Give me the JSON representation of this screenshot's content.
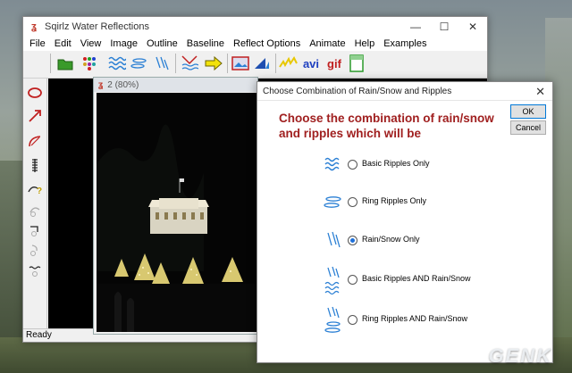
{
  "app": {
    "title": "Sqirlz Water Reflections",
    "menu": [
      "File",
      "Edit",
      "View",
      "Image",
      "Outline",
      "Baseline",
      "Reflect Options",
      "Animate",
      "Help",
      "Examples"
    ],
    "toolbar": [
      "open-folder-icon",
      "palette-icon",
      "basic-ripples-icon",
      "ring-ripples-icon",
      "rain-icon",
      "reflect-icon",
      "arrow-right-icon",
      "photo-icon",
      "sail-icon",
      "lightning-icon",
      "avi-icon",
      "gif-icon",
      "window-icon"
    ],
    "toolbar_text": {
      "avi": "avi",
      "gif": "gif"
    },
    "status": "Ready"
  },
  "document": {
    "title": "2  (80%)"
  },
  "dialog": {
    "title": "Choose Combination of Rain/Snow and Ripples",
    "heading": "Choose the combination of rain/snow and ripples which will be",
    "ok_label": "OK",
    "cancel_label": "Cancel",
    "options": [
      {
        "label": "Basic Ripples Only",
        "selected": false
      },
      {
        "label": "Ring Ripples Only",
        "selected": false
      },
      {
        "label": "Rain/Snow Only",
        "selected": true
      },
      {
        "label": "Basic Ripples  AND  Rain/Snow",
        "selected": false
      },
      {
        "label": "Ring Ripples  AND  Rain/Snow",
        "selected": false
      }
    ]
  },
  "watermark": "GENK",
  "colors": {
    "heading": "#a02020",
    "ripple": "#2a7fd4",
    "radio_selected": "#1e6fd9"
  }
}
